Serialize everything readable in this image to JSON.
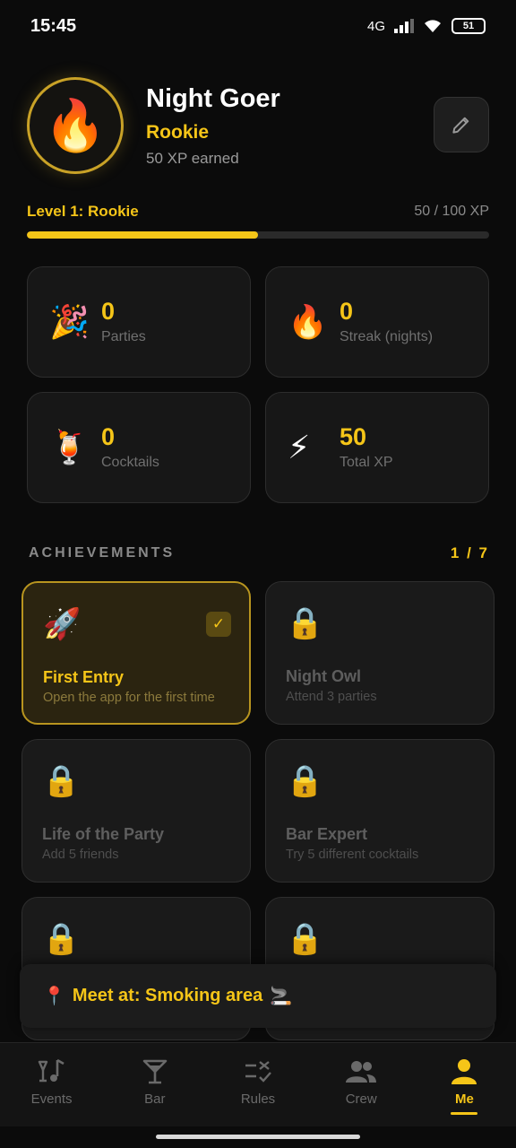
{
  "status_bar": {
    "time": "15:45",
    "network": "4G",
    "battery": "51"
  },
  "profile": {
    "avatar_emoji": "🔥",
    "name": "Night Goer",
    "rank": "Rookie",
    "xp_earned": "50 XP earned"
  },
  "level": {
    "label": "Level 1: Rookie",
    "count": "50 / 100 XP",
    "progress": 0.5
  },
  "stats": [
    {
      "icon": "🎉",
      "value": "0",
      "label": "Parties"
    },
    {
      "icon": "🔥",
      "value": "0",
      "label": "Streak (nights)"
    },
    {
      "icon": "🍹",
      "value": "0",
      "label": "Cocktails"
    },
    {
      "icon": "⚡",
      "value": "50",
      "label": "Total XP"
    }
  ],
  "achievements": {
    "title": "ACHIEVEMENTS",
    "count": "1 / 7",
    "check": "✓",
    "items": [
      {
        "icon": "🚀",
        "name": "First Entry",
        "desc": "Open the app for the first time",
        "unlocked": true
      },
      {
        "icon": "🔒",
        "name": "Night Owl",
        "desc": "Attend 3 parties",
        "unlocked": false
      },
      {
        "icon": "🔒",
        "name": "Life of the Party",
        "desc": "Add 5 friends",
        "unlocked": false
      },
      {
        "icon": "🔒",
        "name": "Bar Expert",
        "desc": "Try 5 different cocktails",
        "unlocked": false
      },
      {
        "icon": "🔒",
        "name": "",
        "desc": "",
        "unlocked": false
      },
      {
        "icon": "🔒",
        "name": "",
        "desc": "",
        "unlocked": false
      }
    ]
  },
  "toast": {
    "icon": "📍",
    "text": "Meet at: Smoking area",
    "emoji": "🚬"
  },
  "nav": {
    "items": [
      {
        "label": "Events",
        "icon": "music-notes-icon"
      },
      {
        "label": "Bar",
        "icon": "cocktail-glass-icon"
      },
      {
        "label": "Rules",
        "icon": "rules-list-icon"
      },
      {
        "label": "Crew",
        "icon": "group-icon"
      },
      {
        "label": "Me",
        "icon": "person-icon"
      }
    ],
    "active": "Me"
  },
  "colors": {
    "accent": "#f5c518",
    "background": "#0b0b0b",
    "card": "#171717"
  }
}
